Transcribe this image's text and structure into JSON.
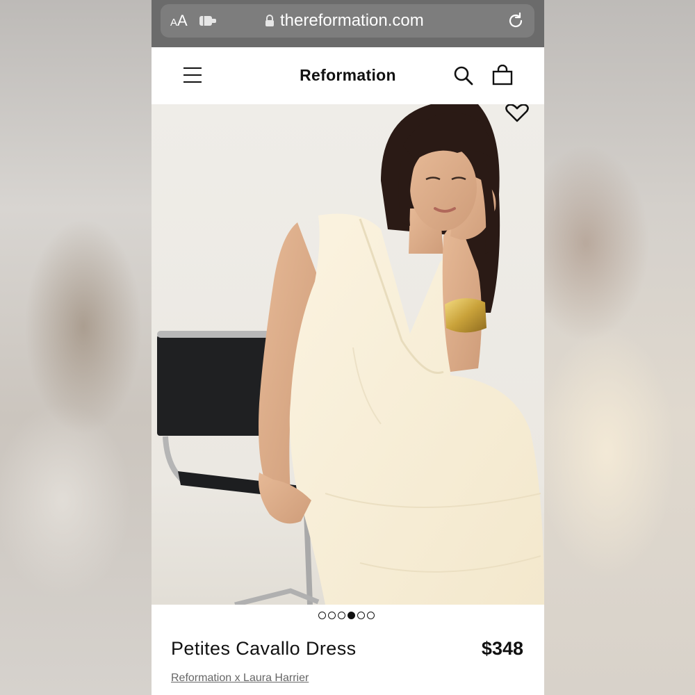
{
  "browser": {
    "text_size_label_small": "A",
    "text_size_label_large": "A",
    "url": "thereformation.com",
    "icons": [
      "text-size-icon",
      "extension-icon",
      "lock-icon",
      "reload-icon"
    ]
  },
  "header": {
    "brand": "Reformation",
    "icons": [
      "menu-icon",
      "search-icon",
      "shopping-bag-icon"
    ]
  },
  "gallery": {
    "image_count": 6,
    "active_index": 3,
    "wishlist_icon": "heart-icon"
  },
  "product": {
    "name": "Petites Cavallo Dress",
    "price": "$348",
    "collaboration": "Reformation x Laura Harrier"
  },
  "colors": {
    "browser_bar": "#6b6b6b",
    "url_field": "#7d7d7d",
    "text": "#111111",
    "muted": "#666666",
    "dress": "#f7efd9",
    "cuff": "#d4b24a"
  }
}
